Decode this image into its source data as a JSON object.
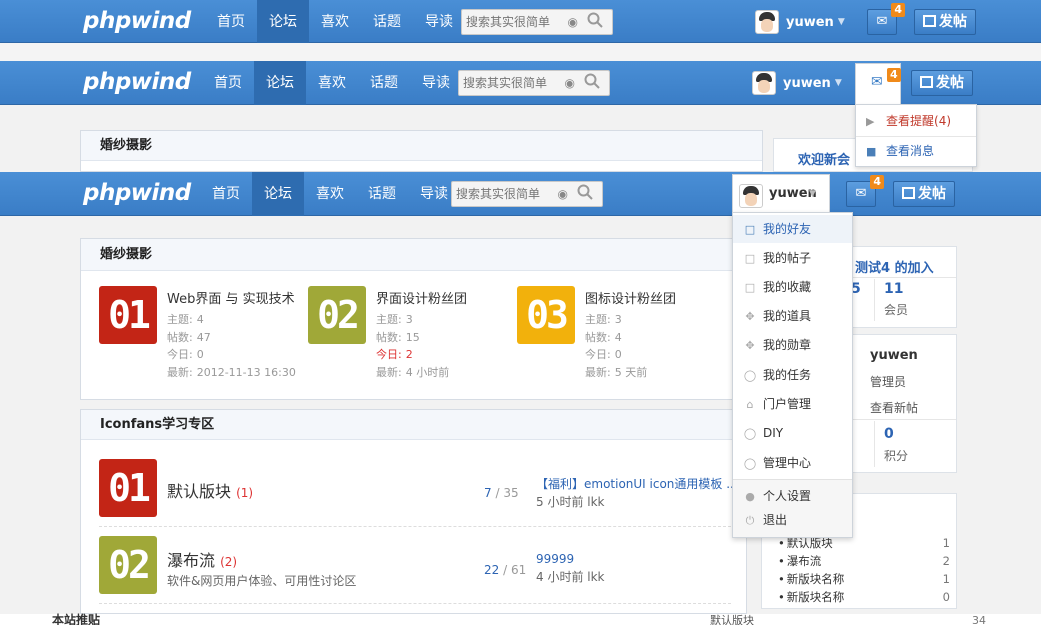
{
  "header": {
    "logo": "phpwind",
    "nav": [
      "首页",
      "论坛",
      "喜欢",
      "话题",
      "导读"
    ],
    "search_placeholder": "搜索其实很简单",
    "username": "yuwen",
    "msg_badge": "4",
    "post_label": "发帖"
  },
  "msg_dropdown": {
    "remind": "查看提醒",
    "remind_count": "(4)",
    "messages": "查看消息"
  },
  "user_dropdown": {
    "items": [
      "我的好友",
      "我的帖子",
      "我的收藏",
      "我的道具",
      "我的勋章",
      "我的任务",
      "门户管理",
      "DIY",
      "管理中心"
    ],
    "footer": [
      "个人设置",
      "退出"
    ]
  },
  "sections": {
    "wedding": {
      "title": "婚纱摄影",
      "forums": [
        {
          "num": "01",
          "name": "Web界面 与 实现技术",
          "topics_label": "主题:",
          "topics": "4",
          "posts_label": "帖数:",
          "posts": "47",
          "today_label": "今日:",
          "today": "0",
          "latest_label": "最新:",
          "latest": "2012-11-13 16:30"
        },
        {
          "num": "02",
          "name": "界面设计粉丝团",
          "topics_label": "主题:",
          "topics": "3",
          "posts_label": "帖数:",
          "posts": "15",
          "today_label": "今日:",
          "today": "2",
          "latest_label": "最新:",
          "latest": "4 小时前"
        },
        {
          "num": "03",
          "name": "图标设计粉丝团",
          "topics_label": "主题:",
          "topics": "3",
          "posts_label": "帖数:",
          "posts": "4",
          "today_label": "今日:",
          "today": "0",
          "latest_label": "最新:",
          "latest": "5 天前"
        }
      ]
    },
    "iconfans": {
      "title": "Iconfans学习专区",
      "rows": [
        {
          "num": "01",
          "name": "默认版块",
          "count": "(1)",
          "desc": "",
          "stat_a": "7",
          "stat_b": " / 35",
          "last_title": "【福利】emotionUI icon通用模板 ...",
          "last_meta": "5 小时前 lkk"
        },
        {
          "num": "02",
          "name": "瀑布流",
          "count": "(2)",
          "desc": "软件&网页用户体验、可用性讨论区",
          "stat_a": "22",
          "stat_b": " / 61",
          "last_title": "99999",
          "last_meta": "4 小时前 lkk"
        }
      ]
    }
  },
  "sidebar": {
    "welcome": "欢迎新会",
    "welcome_full": "测试4 的加入",
    "members_value": "11",
    "members_label": "会员",
    "partial_digit": "5",
    "user": "yuwen",
    "role": "管理员",
    "view_new": "查看新帖",
    "points_value": "0",
    "points_label": "积分",
    "board_list": [
      {
        "name": "默认版块",
        "count": "1"
      },
      {
        "name": "瀑布流",
        "count": "2"
      },
      {
        "name": "新版块名称",
        "count": "1"
      },
      {
        "name": "新版块名称",
        "count": "0"
      }
    ],
    "bottom_left": "本站推贴",
    "bottom_mid": "默认版块",
    "bottom_right": "34"
  }
}
